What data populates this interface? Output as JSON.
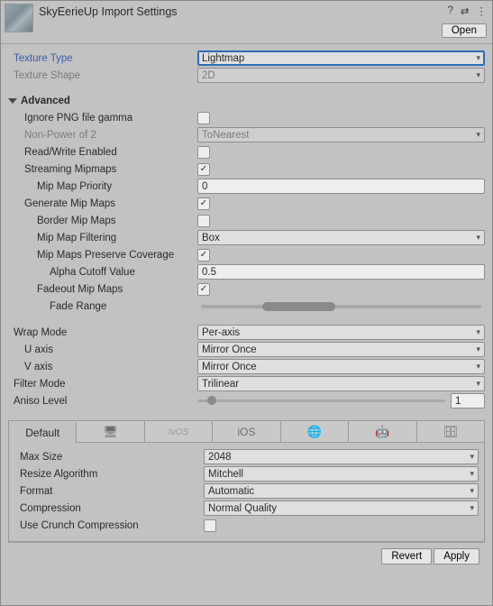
{
  "header": {
    "title": "SkyEerieUp Import Settings",
    "open_label": "Open"
  },
  "fields": {
    "texture_type": {
      "label": "Texture Type",
      "value": "Lightmap"
    },
    "texture_shape": {
      "label": "Texture Shape",
      "value": "2D"
    },
    "advanced_label": "Advanced",
    "ignore_png_gamma": {
      "label": "Ignore PNG file gamma",
      "checked": false
    },
    "npot": {
      "label": "Non-Power of 2",
      "value": "ToNearest"
    },
    "read_write": {
      "label": "Read/Write Enabled",
      "checked": false
    },
    "streaming_mipmaps": {
      "label": "Streaming Mipmaps",
      "checked": true
    },
    "mip_map_priority": {
      "label": "Mip Map Priority",
      "value": "0"
    },
    "generate_mipmaps": {
      "label": "Generate Mip Maps",
      "checked": true
    },
    "border_mipmaps": {
      "label": "Border Mip Maps",
      "checked": false
    },
    "mip_filtering": {
      "label": "Mip Map Filtering",
      "value": "Box"
    },
    "preserve_coverage": {
      "label": "Mip Maps Preserve Coverage",
      "checked": true
    },
    "alpha_cutoff": {
      "label": "Alpha Cutoff Value",
      "value": "0.5"
    },
    "fadeout_mipmaps": {
      "label": "Fadeout Mip Maps",
      "checked": true
    },
    "fade_range": {
      "label": "Fade Range",
      "start_pct": 22,
      "end_pct": 48
    },
    "wrap_mode": {
      "label": "Wrap Mode",
      "value": "Per-axis"
    },
    "u_axis": {
      "label": "U axis",
      "value": "Mirror Once"
    },
    "v_axis": {
      "label": "V axis",
      "value": "Mirror Once"
    },
    "filter_mode": {
      "label": "Filter Mode",
      "value": "Trilinear"
    },
    "aniso": {
      "label": "Aniso Level",
      "value": "1",
      "pct": 4
    }
  },
  "platform": {
    "tabs": [
      "Default",
      "desktop",
      "tvOS",
      "iOS",
      "web",
      "android",
      "server"
    ],
    "active_index": 0,
    "max_size": {
      "label": "Max Size",
      "value": "2048"
    },
    "resize_algo": {
      "label": "Resize Algorithm",
      "value": "Mitchell"
    },
    "format": {
      "label": "Format",
      "value": "Automatic"
    },
    "compression": {
      "label": "Compression",
      "value": "Normal Quality"
    },
    "crunch": {
      "label": "Use Crunch Compression",
      "checked": false
    }
  },
  "footer": {
    "revert": "Revert",
    "apply": "Apply"
  }
}
